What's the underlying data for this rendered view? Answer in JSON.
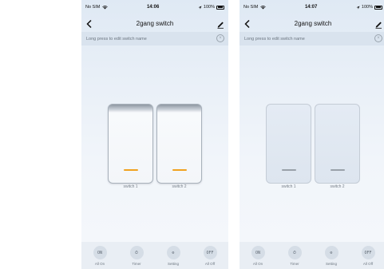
{
  "screens": [
    {
      "status": {
        "carrier": "No SIM",
        "time": "14:06",
        "battery": "100%"
      },
      "nav": {
        "title": "2gang switch"
      },
      "hint": {
        "text": "Long press to edit switch name",
        "close": "×"
      },
      "switches": [
        {
          "label": "switch 1",
          "state": "on"
        },
        {
          "label": "switch 2",
          "state": "on"
        }
      ],
      "actions": [
        {
          "glyph": "ON",
          "label": "All On"
        },
        {
          "glyph": "⏱",
          "label": "Timer"
        },
        {
          "glyph": "⚙",
          "label": "Setting"
        },
        {
          "glyph": "OFF",
          "label": "All Off"
        }
      ]
    },
    {
      "status": {
        "carrier": "No SIM",
        "time": "14:07",
        "battery": "100%"
      },
      "nav": {
        "title": "2gang switch"
      },
      "hint": {
        "text": "Long press to edit switch name",
        "close": "×"
      },
      "switches": [
        {
          "label": "switch 1",
          "state": "off"
        },
        {
          "label": "switch 2",
          "state": "off"
        }
      ],
      "actions": [
        {
          "glyph": "ON",
          "label": "All On"
        },
        {
          "glyph": "⏱",
          "label": "Timer"
        },
        {
          "glyph": "⚙",
          "label": "Setting"
        },
        {
          "glyph": "OFF",
          "label": "All Off"
        }
      ]
    }
  ],
  "colors": {
    "indicator_on": "#f0a21f",
    "indicator_off": "#9aa1a9",
    "hint_bg": "#d9e3ee",
    "action_bg": "#d5dde6"
  }
}
